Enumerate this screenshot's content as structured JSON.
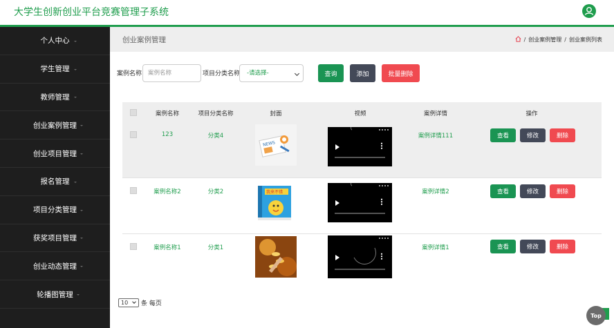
{
  "app": {
    "title": "大学生创新创业平台竞赛管理子系统"
  },
  "sidebar": {
    "items": [
      {
        "label": "个人中心"
      },
      {
        "label": "学生管理"
      },
      {
        "label": "教师管理"
      },
      {
        "label": "创业案例管理"
      },
      {
        "label": "创业项目管理"
      },
      {
        "label": "报名管理"
      },
      {
        "label": "项目分类管理"
      },
      {
        "label": "获奖项目管理"
      },
      {
        "label": "创业动态管理"
      },
      {
        "label": "轮播图管理"
      }
    ]
  },
  "header": {
    "heading": "创业案例管理",
    "breadcrumb": [
      "创业案例管理",
      "创业案例列表"
    ],
    "separator": "/"
  },
  "search": {
    "name_label": "案例名称",
    "name_placeholder": "案例名称",
    "category_label": "项目分类名称",
    "category_value": "-请选择-",
    "query_label": "查询",
    "add_label": "添加",
    "batch_delete_label": "批量删除"
  },
  "table": {
    "columns": [
      "案例名称",
      "项目分类名称",
      "封面",
      "视频",
      "案例详情",
      "操作"
    ],
    "rows": [
      {
        "name": "123",
        "category": "分类4",
        "detail": "案例详情111",
        "cover": "news-image",
        "video": "video-player"
      },
      {
        "name": "案例名称2",
        "category": "分类2",
        "detail": "案例详情2",
        "cover": "book-image",
        "video": "video-player"
      },
      {
        "name": "案例名称1",
        "category": "分类1",
        "detail": "案例详情1",
        "cover": "coins-image",
        "video": "video-player"
      }
    ],
    "actions": {
      "view": "查看",
      "edit": "修改",
      "delete": "删除"
    }
  },
  "pager": {
    "page_size": "10",
    "suffix": "条 每页"
  },
  "back_to_top": "Top",
  "colors": {
    "brand": "#1f9d4d",
    "sidebar": "#1e1e1e",
    "danger": "#f04a50",
    "dark_button": "#434958"
  }
}
